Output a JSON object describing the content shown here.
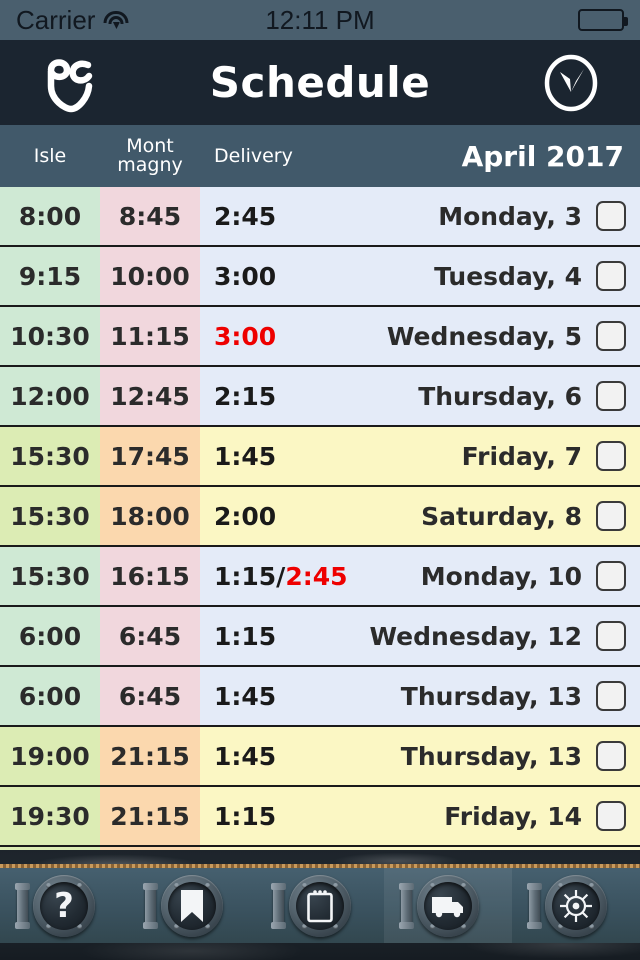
{
  "statusbar": {
    "carrier": "Carrier",
    "wifi_icon": "wifi-icon",
    "time": "12:11 PM",
    "battery_icon": "battery-full-icon",
    "battery_level": "100"
  },
  "navbar": {
    "logo_icon": "pc-monogram-logo",
    "title": "Schedule",
    "right_icon": "clock-icon"
  },
  "columns": {
    "isle": "Isle",
    "mont_line1": "Mont",
    "mont_line2": "magny",
    "delivery": "Delivery",
    "month": "April 2017"
  },
  "colors": {
    "status_bar": "#4a5f6e",
    "nav_bar": "#1b2530",
    "col_header": "#41596a",
    "isle_green": "#cfe9d4",
    "isle_lime": "#dcecb4",
    "mont_pink": "#f1d7dd",
    "mont_peach": "#fbd8ae",
    "rest_blue": "#e4ebf8",
    "rest_yellow": "#fbf7c4",
    "alert_red": "#ee0000",
    "text_dark": "#2b2b2b"
  },
  "rows": [
    {
      "isle": "8:00",
      "mont": "8:45",
      "delivery": "2:45",
      "delivery_alt": "",
      "day": "Monday, 3",
      "isle_bg": "#cfe9d4",
      "mont_bg": "#f1d7dd",
      "rest_bg": "#e4ebf8",
      "delivery_red": false,
      "checked": false
    },
    {
      "isle": "9:15",
      "mont": "10:00",
      "delivery": "3:00",
      "delivery_alt": "",
      "day": "Tuesday, 4",
      "isle_bg": "#cfe9d4",
      "mont_bg": "#f1d7dd",
      "rest_bg": "#e4ebf8",
      "delivery_red": false,
      "checked": false
    },
    {
      "isle": "10:30",
      "mont": "11:15",
      "delivery": "3:00",
      "delivery_alt": "",
      "day": "Wednesday, 5",
      "isle_bg": "#cfe9d4",
      "mont_bg": "#f1d7dd",
      "rest_bg": "#e4ebf8",
      "delivery_red": true,
      "checked": false
    },
    {
      "isle": "12:00",
      "mont": "12:45",
      "delivery": "2:15",
      "delivery_alt": "",
      "day": "Thursday, 6",
      "isle_bg": "#cfe9d4",
      "mont_bg": "#f1d7dd",
      "rest_bg": "#e4ebf8",
      "delivery_red": false,
      "checked": false
    },
    {
      "isle": "15:30",
      "mont": "17:45",
      "delivery": "1:45",
      "delivery_alt": "",
      "day": "Friday, 7",
      "isle_bg": "#dcecb4",
      "mont_bg": "#fbd8ae",
      "rest_bg": "#fbf7c4",
      "delivery_red": false,
      "checked": false
    },
    {
      "isle": "15:30",
      "mont": "18:00",
      "delivery": "2:00",
      "delivery_alt": "",
      "day": "Saturday, 8",
      "isle_bg": "#dcecb4",
      "mont_bg": "#fbd8ae",
      "rest_bg": "#fbf7c4",
      "delivery_red": false,
      "checked": false
    },
    {
      "isle": "15:30",
      "mont": "16:15",
      "delivery": "1:15/",
      "delivery_alt": "2:45",
      "day": "Monday, 10",
      "isle_bg": "#cfe9d4",
      "mont_bg": "#f1d7dd",
      "rest_bg": "#e4ebf8",
      "delivery_red": false,
      "checked": false
    },
    {
      "isle": "6:00",
      "mont": "6:45",
      "delivery": "1:15",
      "delivery_alt": "",
      "day": "Wednesday, 12",
      "isle_bg": "#cfe9d4",
      "mont_bg": "#f1d7dd",
      "rest_bg": "#e4ebf8",
      "delivery_red": false,
      "checked": false
    },
    {
      "isle": "6:00",
      "mont": "6:45",
      "delivery": "1:45",
      "delivery_alt": "",
      "day": "Thursday, 13",
      "isle_bg": "#cfe9d4",
      "mont_bg": "#f1d7dd",
      "rest_bg": "#e4ebf8",
      "delivery_red": false,
      "checked": false
    },
    {
      "isle": "19:00",
      "mont": "21:15",
      "delivery": "1:45",
      "delivery_alt": "",
      "day": "Thursday, 13",
      "isle_bg": "#dcecb4",
      "mont_bg": "#fbd8ae",
      "rest_bg": "#fbf7c4",
      "delivery_red": false,
      "checked": false
    },
    {
      "isle": "19:30",
      "mont": "21:15",
      "delivery": "1:15",
      "delivery_alt": "",
      "day": "Friday, 14",
      "isle_bg": "#dcecb4",
      "mont_bg": "#fbd8ae",
      "rest_bg": "#fbf7c4",
      "delivery_red": false,
      "checked": false
    },
    {
      "isle": "",
      "mont": "",
      "delivery": "",
      "delivery_alt": "",
      "day": "",
      "isle_bg": "#dcecb4",
      "mont_bg": "#fbd8ae",
      "rest_bg": "#fbf7c4",
      "delivery_red": false,
      "checked": false
    }
  ],
  "tabbar": {
    "tabs": [
      {
        "icon": "question-mark-icon",
        "active": false
      },
      {
        "icon": "bookmark-icon",
        "active": false
      },
      {
        "icon": "notepad-icon",
        "active": false
      },
      {
        "icon": "truck-icon",
        "active": true
      },
      {
        "icon": "ship-wheel-icon",
        "active": false
      }
    ]
  }
}
